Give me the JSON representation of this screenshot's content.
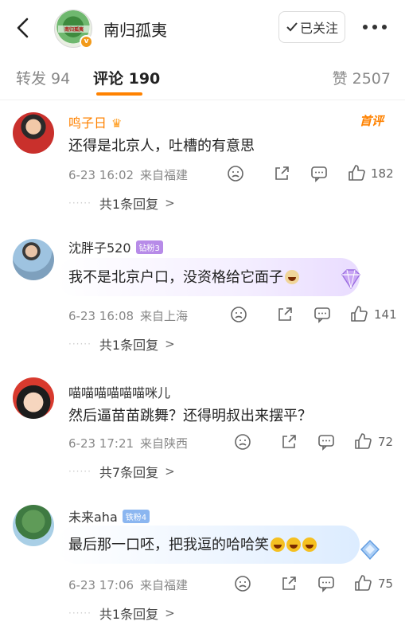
{
  "header": {
    "title": "南归孤夷",
    "avatar_text": "南归孤夷",
    "follow_label": "已关注"
  },
  "tabs": {
    "repost": "转发 94",
    "comment": "评论 190",
    "like": "赞 2507"
  },
  "comments": [
    {
      "name": "鸣子日",
      "text": "还得是北京人，吐槽的有意思",
      "time": "6-23 16:02",
      "location": "来自福建",
      "likes": "182",
      "replies": "共1条回复",
      "tag": "首评"
    },
    {
      "name": "沈胖子520",
      "badge": "钻粉3",
      "text": "我不是北京户口，没资格给它面子",
      "time": "6-23 16:08",
      "location": "来自上海",
      "likes": "141",
      "replies": "共1条回复"
    },
    {
      "name": "喵喵喵喵喵喵咪儿",
      "text": "然后逼苗苗跳舞？还得明叔出来摆平？",
      "time": "6-23 17:21",
      "location": "来自陕西",
      "likes": "72",
      "replies": "共7条回复"
    },
    {
      "name": "未来aha",
      "badge": "铁粉4",
      "text": "最后那一口呸，把我逗的哈哈笑",
      "time": "6-23 17:06",
      "location": "来自福建",
      "likes": "75",
      "replies": "共1条回复"
    }
  ],
  "icons": [
    "back-arrow-icon",
    "check-icon",
    "more-icon",
    "dislike-icon",
    "share-icon",
    "comment-icon",
    "thumbs-up-icon",
    "gem-icon",
    "crown-icon"
  ],
  "colors": {
    "accent": "#ff8200",
    "muted": "#888888"
  }
}
